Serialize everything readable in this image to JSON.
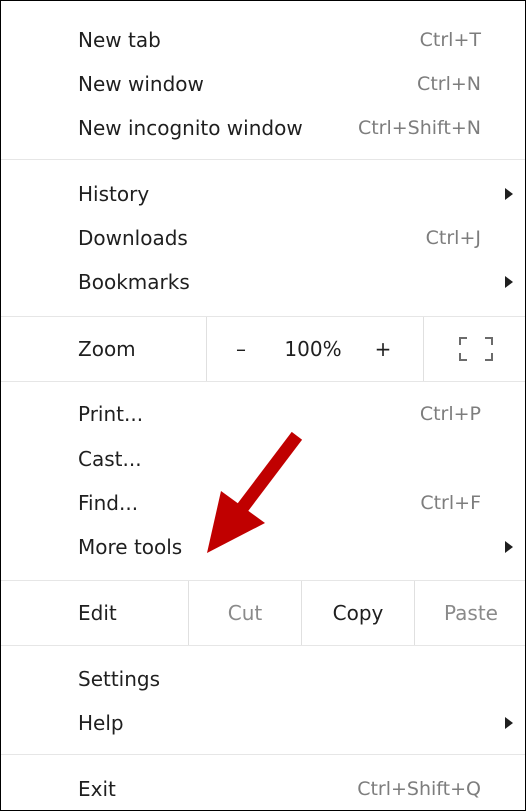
{
  "menu": {
    "group1": [
      {
        "label": "New tab",
        "shortcut": "Ctrl+T"
      },
      {
        "label": "New window",
        "shortcut": "Ctrl+N"
      },
      {
        "label": "New incognito window",
        "shortcut": "Ctrl+Shift+N"
      }
    ],
    "group2": [
      {
        "label": "History",
        "shortcut": ""
      },
      {
        "label": "Downloads",
        "shortcut": "Ctrl+J"
      },
      {
        "label": "Bookmarks",
        "shortcut": ""
      }
    ],
    "zoom": {
      "label": "Zoom",
      "minus": "–",
      "value": "100%",
      "plus": "+"
    },
    "group3": [
      {
        "label": "Print...",
        "shortcut": "Ctrl+P"
      },
      {
        "label": "Cast...",
        "shortcut": ""
      },
      {
        "label": "Find...",
        "shortcut": "Ctrl+F"
      },
      {
        "label": "More tools",
        "shortcut": ""
      }
    ],
    "edit": {
      "label": "Edit",
      "cut": "Cut",
      "copy": "Copy",
      "paste": "Paste"
    },
    "group4": [
      {
        "label": "Settings",
        "shortcut": ""
      },
      {
        "label": "Help",
        "shortcut": ""
      }
    ],
    "exit": {
      "label": "Exit",
      "shortcut": "Ctrl+Shift+Q"
    }
  },
  "colors": {
    "annotation_arrow": "#c00000",
    "shortcut_text": "#7d7d7d",
    "disabled_text": "#8a8a8a"
  },
  "icons": {
    "submenu": "chevron-right-icon",
    "fullscreen": "fullscreen-icon",
    "annotation": "annotation-arrow-icon"
  }
}
